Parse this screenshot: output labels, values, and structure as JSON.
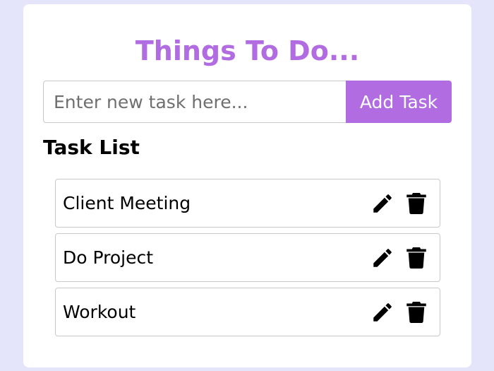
{
  "header": {
    "title": "Things To Do..."
  },
  "new_task": {
    "placeholder": "Enter new task here...",
    "value": "",
    "add_button_label": "Add Task"
  },
  "task_list": {
    "heading": "Task List",
    "items": [
      {
        "label": "Client Meeting",
        "edit_icon": "pencil-icon",
        "delete_icon": "trash-icon"
      },
      {
        "label": "Do Project",
        "edit_icon": "pencil-icon",
        "delete_icon": "trash-icon"
      },
      {
        "label": "Workout",
        "edit_icon": "pencil-icon",
        "delete_icon": "trash-icon"
      }
    ]
  },
  "colors": {
    "accent": "#b06ce0",
    "page_background": "#e4e4fb",
    "card_background": "#ffffff",
    "border": "#c9c9c9"
  }
}
